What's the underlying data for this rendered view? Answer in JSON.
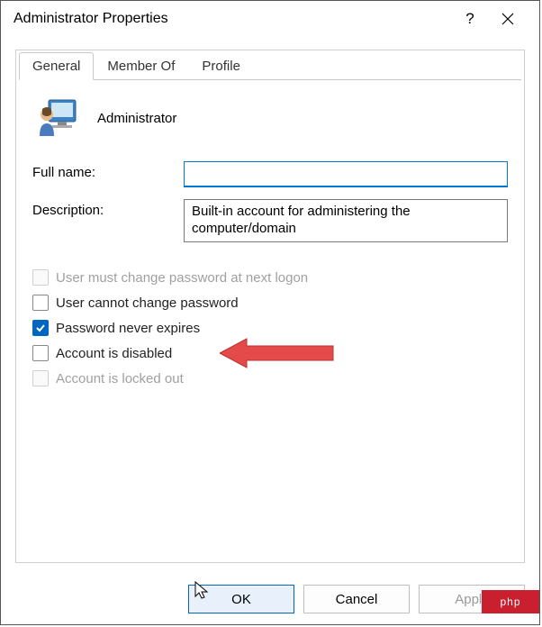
{
  "window": {
    "title": "Administrator Properties"
  },
  "tabs": {
    "items": [
      {
        "label": "General",
        "active": true
      },
      {
        "label": "Member Of",
        "active": false
      },
      {
        "label": "Profile",
        "active": false
      }
    ]
  },
  "account": {
    "display_name": "Administrator"
  },
  "fields": {
    "full_name_label": "Full name:",
    "full_name_value": "",
    "description_label": "Description:",
    "description_value": "Built-in account for administering the computer/domain"
  },
  "checkboxes": {
    "must_change": {
      "label": "User must change password at next logon",
      "checked": false,
      "disabled": true
    },
    "cannot_change": {
      "label": "User cannot change password",
      "checked": false,
      "disabled": false
    },
    "never_expires": {
      "label": "Password never expires",
      "checked": true,
      "disabled": false
    },
    "disabled_acct": {
      "label": "Account is disabled",
      "checked": false,
      "disabled": false
    },
    "locked_out": {
      "label": "Account is locked out",
      "checked": false,
      "disabled": true
    }
  },
  "buttons": {
    "ok": "OK",
    "cancel": "Cancel",
    "apply": "Apply"
  },
  "watermark": "php"
}
